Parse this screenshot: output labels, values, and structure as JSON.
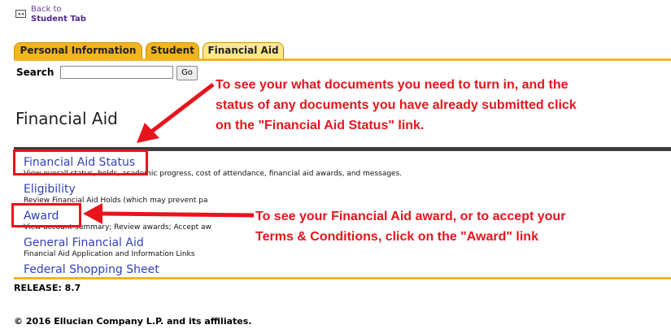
{
  "back": {
    "icon_glyph": "◂◂",
    "line1": "Back to",
    "line2": "Student Tab"
  },
  "tabs": [
    {
      "label": "Personal Information",
      "active": false
    },
    {
      "label": "Student",
      "active": false
    },
    {
      "label": "Financial Aid",
      "active": true
    }
  ],
  "search": {
    "label": "Search",
    "value": "",
    "button": "Go"
  },
  "page_title": "Financial Aid",
  "menu": [
    {
      "label": "Financial Aid Status",
      "description": "View overall status, holds, academic progress, cost of attendance, financial aid awards, and messages."
    },
    {
      "label": "Eligibility",
      "description": "Review Financial Aid Holds (which may prevent pa"
    },
    {
      "label": "Award",
      "description": "View account summary; Review awards; Accept aw"
    },
    {
      "label": "General Financial Aid",
      "description": "Financial Aid Application and Information Links"
    },
    {
      "label": "Federal Shopping Sheet",
      "description": ""
    }
  ],
  "release": "RELEASE: 8.7",
  "copyright": "© 2016 Ellucian Company L.P. and its affiliates.",
  "annotations": {
    "status_note": [
      "To see your what documents you need to turn in, and the",
      "status of any documents you have already submitted click",
      "on the \"Financial Aid Status\" link."
    ],
    "award_note": [
      "To see your Financial Aid award, or to accept your",
      "Terms & Conditions, click on the \"Award\" link"
    ]
  },
  "colors": {
    "tab": "#f3b422",
    "tab_active": "#ffe88a",
    "link": "#3142b8",
    "annotation": "#e8141c",
    "dark_bar": "#3d3d3d"
  }
}
